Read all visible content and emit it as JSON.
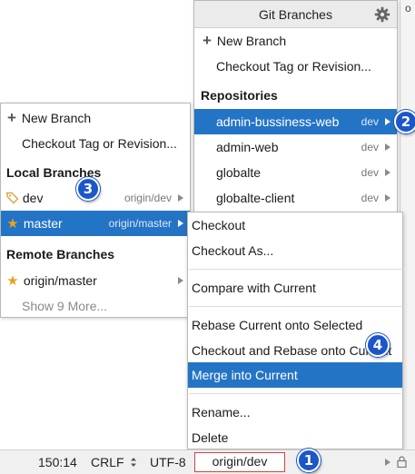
{
  "edge_char": "o",
  "git_popup": {
    "title": "Git Branches",
    "new_branch": "New Branch",
    "checkout_tag": "Checkout Tag or Revision...",
    "repositories_header": "Repositories",
    "repos": [
      {
        "name": "admin-bussiness-web",
        "branch": "dev"
      },
      {
        "name": "admin-web",
        "branch": "dev"
      },
      {
        "name": "globalte",
        "branch": "dev"
      },
      {
        "name": "globalte-client",
        "branch": "dev"
      }
    ]
  },
  "branch_popup": {
    "new_branch": "New Branch",
    "checkout_tag": "Checkout Tag or Revision...",
    "local_header": "Local Branches",
    "local": [
      {
        "name": "dev",
        "tracking": "origin/dev"
      },
      {
        "name": "master",
        "tracking": "origin/master"
      }
    ],
    "remote_header": "Remote Branches",
    "remote": [
      {
        "name": "origin/master"
      }
    ],
    "show_more": "Show 9 More..."
  },
  "context_menu": {
    "items": [
      "Checkout",
      "Checkout As...",
      "Compare with Current",
      "Rebase Current onto Selected",
      "Checkout and Rebase onto Current",
      "Merge into Current",
      "Rename...",
      "Delete"
    ]
  },
  "status_bar": {
    "position": "150:14",
    "line_sep": "CRLF",
    "encoding": "UTF-8",
    "branch": "origin/dev"
  },
  "callouts": [
    "1",
    "2",
    "3",
    "4"
  ],
  "colors": {
    "selection": "#2474c6",
    "callout": "#1b57c9",
    "highlight_border": "#d84040",
    "star": "#e8a21a"
  }
}
